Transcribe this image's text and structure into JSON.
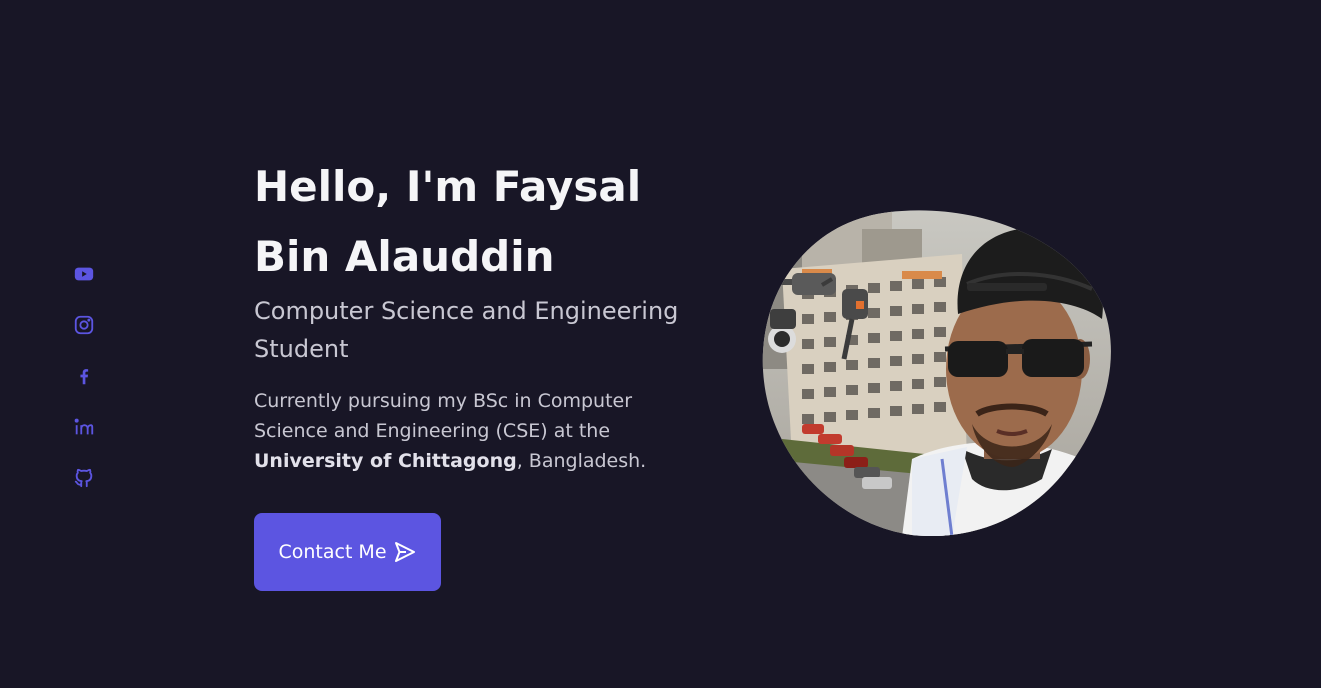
{
  "hero": {
    "title": "Hello, I'm Faysal Bin Alauddin",
    "subtitle": "Computer Science and Engineering Student",
    "description_part1": "Currently pursuing my BSc in Computer Science and Engineering (CSE) at the",
    "description_bold": "University of Chittagong",
    "description_part2": ", Bangladesh.",
    "contact_label": "Contact Me"
  },
  "social": {
    "icons": [
      "youtube-icon",
      "instagram-icon",
      "facebook-icon",
      "linkedin-icon",
      "github-icon"
    ]
  },
  "colors": {
    "background": "#181626",
    "accent": "#5c55e1",
    "heading": "#f5f5f7",
    "body_text": "#c8c7d2"
  }
}
